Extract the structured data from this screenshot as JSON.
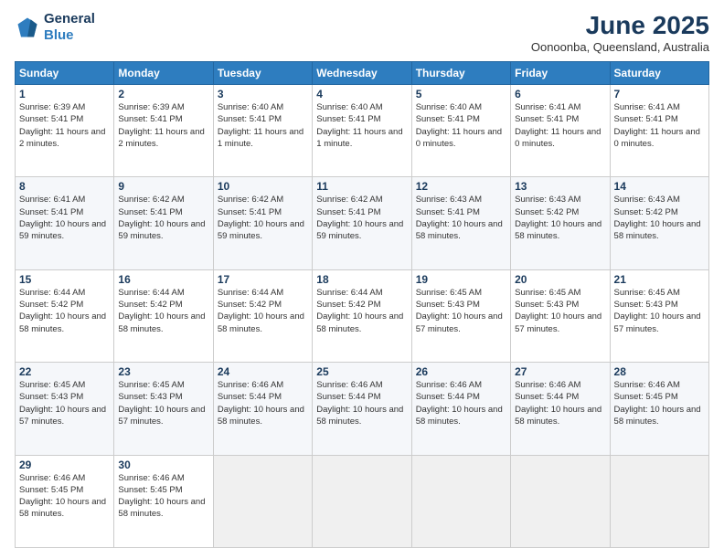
{
  "logo": {
    "line1": "General",
    "line2": "Blue"
  },
  "header": {
    "month_year": "June 2025",
    "location": "Oonoonba, Queensland, Australia"
  },
  "days_of_week": [
    "Sunday",
    "Monday",
    "Tuesday",
    "Wednesday",
    "Thursday",
    "Friday",
    "Saturday"
  ],
  "weeks": [
    [
      {
        "day": "1",
        "sunrise": "6:39 AM",
        "sunset": "5:41 PM",
        "daylight": "11 hours and 2 minutes."
      },
      {
        "day": "2",
        "sunrise": "6:39 AM",
        "sunset": "5:41 PM",
        "daylight": "11 hours and 2 minutes."
      },
      {
        "day": "3",
        "sunrise": "6:40 AM",
        "sunset": "5:41 PM",
        "daylight": "11 hours and 1 minute."
      },
      {
        "day": "4",
        "sunrise": "6:40 AM",
        "sunset": "5:41 PM",
        "daylight": "11 hours and 1 minute."
      },
      {
        "day": "5",
        "sunrise": "6:40 AM",
        "sunset": "5:41 PM",
        "daylight": "11 hours and 0 minutes."
      },
      {
        "day": "6",
        "sunrise": "6:41 AM",
        "sunset": "5:41 PM",
        "daylight": "11 hours and 0 minutes."
      },
      {
        "day": "7",
        "sunrise": "6:41 AM",
        "sunset": "5:41 PM",
        "daylight": "11 hours and 0 minutes."
      }
    ],
    [
      {
        "day": "8",
        "sunrise": "6:41 AM",
        "sunset": "5:41 PM",
        "daylight": "10 hours and 59 minutes."
      },
      {
        "day": "9",
        "sunrise": "6:42 AM",
        "sunset": "5:41 PM",
        "daylight": "10 hours and 59 minutes."
      },
      {
        "day": "10",
        "sunrise": "6:42 AM",
        "sunset": "5:41 PM",
        "daylight": "10 hours and 59 minutes."
      },
      {
        "day": "11",
        "sunrise": "6:42 AM",
        "sunset": "5:41 PM",
        "daylight": "10 hours and 59 minutes."
      },
      {
        "day": "12",
        "sunrise": "6:43 AM",
        "sunset": "5:41 PM",
        "daylight": "10 hours and 58 minutes."
      },
      {
        "day": "13",
        "sunrise": "6:43 AM",
        "sunset": "5:42 PM",
        "daylight": "10 hours and 58 minutes."
      },
      {
        "day": "14",
        "sunrise": "6:43 AM",
        "sunset": "5:42 PM",
        "daylight": "10 hours and 58 minutes."
      }
    ],
    [
      {
        "day": "15",
        "sunrise": "6:44 AM",
        "sunset": "5:42 PM",
        "daylight": "10 hours and 58 minutes."
      },
      {
        "day": "16",
        "sunrise": "6:44 AM",
        "sunset": "5:42 PM",
        "daylight": "10 hours and 58 minutes."
      },
      {
        "day": "17",
        "sunrise": "6:44 AM",
        "sunset": "5:42 PM",
        "daylight": "10 hours and 58 minutes."
      },
      {
        "day": "18",
        "sunrise": "6:44 AM",
        "sunset": "5:42 PM",
        "daylight": "10 hours and 58 minutes."
      },
      {
        "day": "19",
        "sunrise": "6:45 AM",
        "sunset": "5:43 PM",
        "daylight": "10 hours and 57 minutes."
      },
      {
        "day": "20",
        "sunrise": "6:45 AM",
        "sunset": "5:43 PM",
        "daylight": "10 hours and 57 minutes."
      },
      {
        "day": "21",
        "sunrise": "6:45 AM",
        "sunset": "5:43 PM",
        "daylight": "10 hours and 57 minutes."
      }
    ],
    [
      {
        "day": "22",
        "sunrise": "6:45 AM",
        "sunset": "5:43 PM",
        "daylight": "10 hours and 57 minutes."
      },
      {
        "day": "23",
        "sunrise": "6:45 AM",
        "sunset": "5:43 PM",
        "daylight": "10 hours and 57 minutes."
      },
      {
        "day": "24",
        "sunrise": "6:46 AM",
        "sunset": "5:44 PM",
        "daylight": "10 hours and 58 minutes."
      },
      {
        "day": "25",
        "sunrise": "6:46 AM",
        "sunset": "5:44 PM",
        "daylight": "10 hours and 58 minutes."
      },
      {
        "day": "26",
        "sunrise": "6:46 AM",
        "sunset": "5:44 PM",
        "daylight": "10 hours and 58 minutes."
      },
      {
        "day": "27",
        "sunrise": "6:46 AM",
        "sunset": "5:44 PM",
        "daylight": "10 hours and 58 minutes."
      },
      {
        "day": "28",
        "sunrise": "6:46 AM",
        "sunset": "5:45 PM",
        "daylight": "10 hours and 58 minutes."
      }
    ],
    [
      {
        "day": "29",
        "sunrise": "6:46 AM",
        "sunset": "5:45 PM",
        "daylight": "10 hours and 58 minutes."
      },
      {
        "day": "30",
        "sunrise": "6:46 AM",
        "sunset": "5:45 PM",
        "daylight": "10 hours and 58 minutes."
      },
      {
        "day": "",
        "sunrise": "",
        "sunset": "",
        "daylight": ""
      },
      {
        "day": "",
        "sunrise": "",
        "sunset": "",
        "daylight": ""
      },
      {
        "day": "",
        "sunrise": "",
        "sunset": "",
        "daylight": ""
      },
      {
        "day": "",
        "sunrise": "",
        "sunset": "",
        "daylight": ""
      },
      {
        "day": "",
        "sunrise": "",
        "sunset": "",
        "daylight": ""
      }
    ]
  ]
}
